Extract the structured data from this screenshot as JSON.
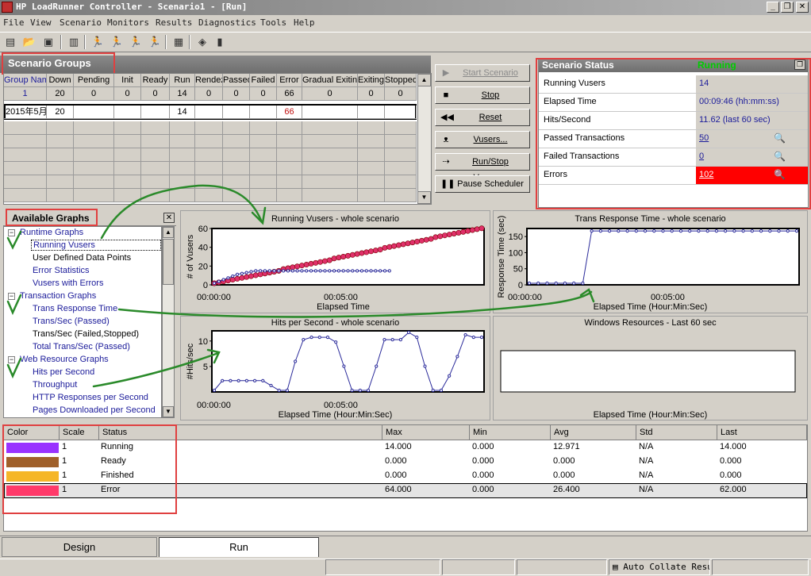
{
  "app": {
    "title": "HP LoadRunner Controller - Scenario1 - [Run]",
    "window_buttons": [
      "_",
      "❐",
      "✕"
    ]
  },
  "menu": [
    "File",
    "View",
    "Scenario",
    "Monitors",
    "Results",
    "Diagnostics",
    "Tools",
    "Help"
  ],
  "toolbar": {
    "icons": [
      "new-icon",
      "open-icon",
      "save-icon",
      "building-icon",
      "run-vusers-icon",
      "run-vusers-icon",
      "stop-vusers-icon",
      "stop-vusers-icon",
      "report-icon",
      "analysis-icon",
      "bar-chart-icon"
    ]
  },
  "scenario_groups": {
    "title": "Scenario Groups",
    "columns": [
      "Group Nam",
      "Down",
      "Pending",
      "Init",
      "Ready",
      "Run",
      "Rendez",
      "Passed",
      "Failed",
      "Error",
      "Gradual Exiting",
      "Exiting",
      "Stopped"
    ],
    "totals": [
      "1",
      "20",
      "0",
      "0",
      "0",
      "14",
      "0",
      "0",
      "0",
      "66",
      "0",
      "0",
      "0"
    ],
    "rows": [
      [
        "2015年5月",
        "20",
        "",
        "",
        "",
        "14",
        "",
        "",
        "",
        "66",
        "",
        "",
        ""
      ]
    ]
  },
  "controls": {
    "start": "Start Scenario",
    "stop": "Stop",
    "reset": "Reset",
    "vusers": "Vusers...",
    "run_stop_vusers": "Run/Stop Vusers...",
    "pause_scheduler": "Pause Scheduler"
  },
  "scenario_status": {
    "title": "Scenario Status",
    "state": "Running",
    "rows": [
      {
        "label": "Running Vusers",
        "value": "14"
      },
      {
        "label": "Elapsed Time",
        "value": "00:09:46 (hh:mm:ss)"
      },
      {
        "label": "Hits/Second",
        "value": "11.62 (last 60 sec)"
      },
      {
        "label": "Passed Transactions",
        "value": "50"
      },
      {
        "label": "Failed Transactions",
        "value": "0"
      },
      {
        "label": "Errors",
        "value": "102"
      }
    ]
  },
  "available_graphs": {
    "title": "Available Graphs",
    "groups": [
      {
        "label": "Runtime Graphs",
        "items": [
          "Running Vusers",
          "User Defined Data Points",
          "Error Statistics",
          "Vusers with Errors"
        ]
      },
      {
        "label": "Transaction Graphs",
        "items": [
          "Trans Response Time",
          "Trans/Sec (Passed)",
          "Trans/Sec (Failed,Stopped)",
          "Total Trans/Sec (Passed)"
        ]
      },
      {
        "label": "Web Resource Graphs",
        "items": [
          "Hits per Second",
          "Throughput",
          "HTTP Responses per Second",
          "Pages Downloaded per Second"
        ]
      }
    ]
  },
  "chart_data": [
    {
      "type": "line",
      "title": "Running Vusers - whole scenario",
      "xlabel": "Elapsed Time",
      "ylabel": "# of Vusers",
      "ylim": [
        0,
        60
      ],
      "yticks": [
        "60",
        "40",
        "20",
        "0"
      ],
      "xticks": [
        "00:00:00",
        "00:05:00"
      ],
      "series": [
        {
          "color": "#e0306a",
          "values": [
            0,
            1,
            2,
            3,
            4,
            5,
            6,
            7,
            8,
            9,
            10,
            11,
            12,
            13,
            14,
            16,
            17,
            18,
            19,
            20,
            21,
            22,
            23,
            24,
            25,
            26,
            28,
            29,
            30,
            31,
            32,
            33,
            34,
            35,
            36,
            37,
            38,
            40,
            41,
            42,
            43,
            44,
            45,
            46,
            47,
            48,
            49,
            50,
            52,
            53,
            54,
            55,
            56,
            57,
            58,
            59,
            60,
            61,
            62
          ]
        },
        {
          "color": "#2a2a9a",
          "values": [
            0,
            2,
            4,
            6,
            8,
            10,
            11,
            12,
            13,
            14,
            14,
            14,
            14,
            14,
            14,
            14,
            14,
            14,
            14,
            14,
            14,
            14,
            14,
            14,
            14,
            14,
            14,
            14,
            14,
            14,
            14,
            14,
            14,
            14,
            14,
            14,
            14,
            14,
            14
          ]
        }
      ]
    },
    {
      "type": "line",
      "title": "Trans Response Time - whole scenario",
      "xlabel": "Elapsed Time (Hour:Min:Sec)",
      "ylabel": "Response Time (sec)",
      "ylim": [
        0,
        175
      ],
      "yticks": [
        "150",
        "100",
        "50",
        "0"
      ],
      "xticks": [
        "00:00:00",
        "00:05:00"
      ],
      "series": [
        {
          "color": "#2a2a9a",
          "values": [
            0,
            0,
            0,
            0,
            0,
            0,
            0,
            172,
            172,
            172,
            172,
            172,
            172,
            172,
            172,
            172,
            172,
            172,
            172,
            172,
            172,
            172,
            172,
            172,
            172,
            172,
            172,
            172,
            172,
            172,
            172
          ]
        }
      ]
    },
    {
      "type": "line",
      "title": "Hits per Second - whole scenario",
      "xlabel": "Elapsed Time (Hour:Min:Sec)",
      "ylabel": "#Hits/sec",
      "ylim": [
        0,
        12
      ],
      "yticks": [
        "10",
        "5"
      ],
      "xticks": [
        "00:00:00",
        "00:05:00"
      ],
      "series": [
        {
          "color": "#2a2a9a",
          "values": [
            0,
            2,
            2,
            2,
            2,
            2,
            2,
            1,
            0,
            0,
            6,
            10.5,
            11,
            11,
            11,
            10,
            5,
            0,
            0,
            0,
            5,
            10.5,
            10.5,
            10.5,
            12,
            11,
            5,
            0,
            0,
            3,
            7,
            11.5,
            11,
            11
          ]
        }
      ]
    },
    {
      "type": "line",
      "title": "Windows Resources - Last 60 sec",
      "xlabel": "Elapsed Time (Hour:Min:Sec)",
      "ylabel": "",
      "series": []
    }
  ],
  "legend_table": {
    "columns": [
      "Color",
      "Scale",
      "Status",
      "Max",
      "Min",
      "Avg",
      "Std",
      "Last"
    ],
    "rows": [
      {
        "color": "#9933ff",
        "scale": "1",
        "status": "Running",
        "max": "14.000",
        "min": "0.000",
        "avg": "12.971",
        "std": "N/A",
        "last": "14.000"
      },
      {
        "color": "#a0602a",
        "scale": "1",
        "status": "Ready",
        "max": "0.000",
        "min": "0.000",
        "avg": "0.000",
        "std": "N/A",
        "last": "0.000"
      },
      {
        "color": "#f5b628",
        "scale": "1",
        "status": "Finished",
        "max": "0.000",
        "min": "0.000",
        "avg": "0.000",
        "std": "N/A",
        "last": "0.000"
      },
      {
        "color": "#ff3a6a",
        "scale": "1",
        "status": "Error",
        "max": "64.000",
        "min": "0.000",
        "avg": "26.400",
        "std": "N/A",
        "last": "62.000"
      }
    ]
  },
  "tabs": [
    "Design",
    "Run"
  ],
  "statusbar": {
    "auto_collate": "Auto Collate Resu"
  },
  "colors": {
    "running_green": "#00cc00",
    "errors_red": "#ff0000",
    "annotation_red": "#e04040",
    "annotation_green": "#2a8a2a"
  }
}
